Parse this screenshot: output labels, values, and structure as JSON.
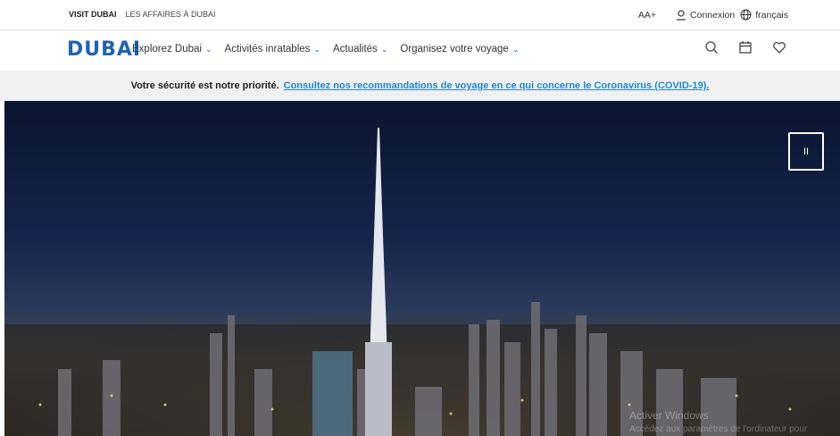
{
  "topbar": {
    "visit_dubai": "VISIT DUBAI",
    "affaires": "LES AFFAIRES À DUBAI",
    "aa": "AA+",
    "connexion": "Connexion",
    "language": "français"
  },
  "nav": {
    "logo": "DUBAI",
    "items": [
      {
        "label": "Explorez Dubai"
      },
      {
        "label": "Activités inratables"
      },
      {
        "label": "Actualités"
      },
      {
        "label": "Organisez votre voyage"
      }
    ],
    "icons": [
      "search-icon",
      "calendar-icon",
      "heart-icon"
    ]
  },
  "banner": {
    "lead": "Votre sécurité est notre priorité.",
    "link": "Consultez nos recommandations de voyage en ce qui concerne le Coronavirus (COVID-19)."
  },
  "hero": {
    "pause_label": "II",
    "watermark_line1": "Activer Windows",
    "watermark_line2": "Accédez aux paramètres de l'ordinateur pour"
  }
}
